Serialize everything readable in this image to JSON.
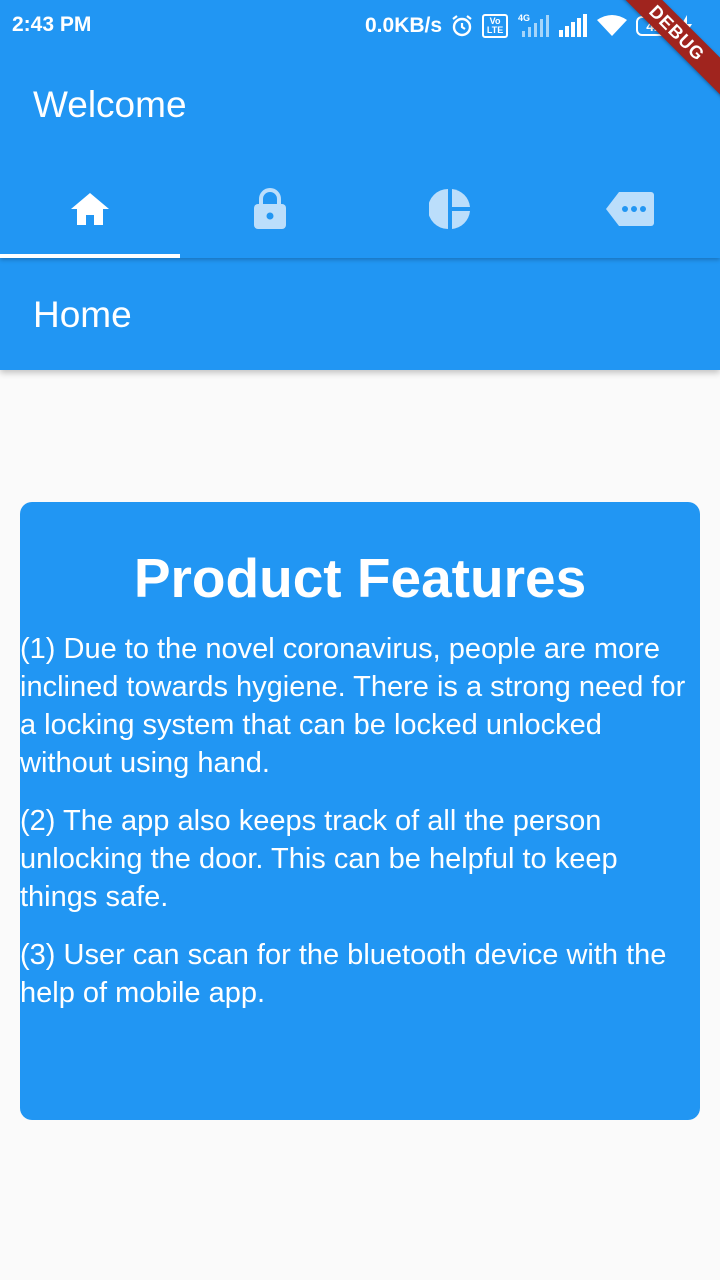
{
  "status_bar": {
    "time": "2:43 PM",
    "network_speed": "0.0KB/s",
    "volte_label": "Vo LTE",
    "network_type": "4G",
    "battery_level": "42",
    "icons": [
      "alarm-icon",
      "volte-icon",
      "signal-icon",
      "wifi-icon",
      "battery-icon",
      "charging-icon"
    ]
  },
  "debug_banner": "DEBUG",
  "app_bar": {
    "title": "Welcome"
  },
  "tabs": [
    {
      "icon": "home-icon",
      "selected": true
    },
    {
      "icon": "lock-icon",
      "selected": false
    },
    {
      "icon": "pie-chart-icon",
      "selected": false
    },
    {
      "icon": "label-more-icon",
      "selected": false
    }
  ],
  "section": {
    "title": "Home"
  },
  "card": {
    "title": "Product Features",
    "paragraphs": [
      "(1) Due to the novel coronavirus, people are more inclined towards hygiene. There is a strong need for a locking system that can be locked unlocked without using hand.",
      "(2) The app also keeps track of all the person unlocking the door. This can be helpful to keep things safe.",
      "(3) User can scan for the bluetooth device with the help of mobile app."
    ]
  },
  "colors": {
    "primary": "#2196f3",
    "background": "#fafafa",
    "debug": "#a0241e",
    "inactive_icon": "#bbdefb"
  }
}
